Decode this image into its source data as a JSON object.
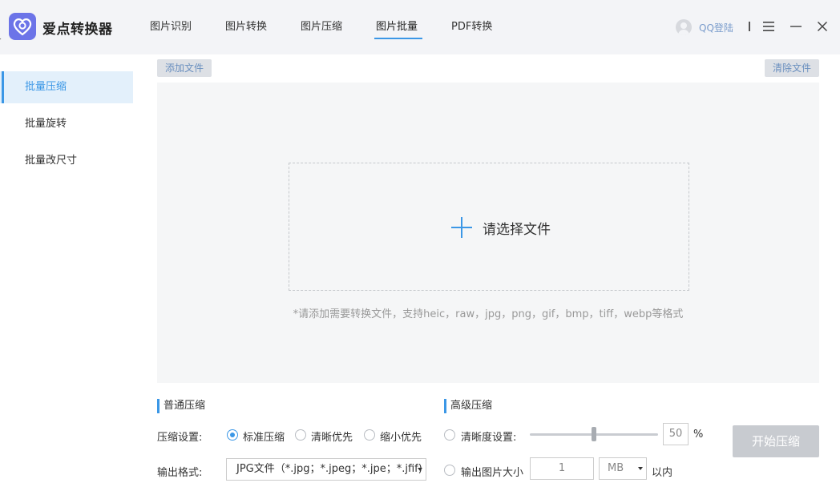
{
  "app": {
    "title": "爱点转换器"
  },
  "nav": {
    "tabs": [
      {
        "label": "图片识别"
      },
      {
        "label": "图片转换"
      },
      {
        "label": "图片压缩"
      },
      {
        "label": "图片批量"
      },
      {
        "label": "PDF转换"
      }
    ],
    "active_index": 3
  },
  "user": {
    "login_label": "QQ登陆"
  },
  "sidebar": {
    "items": [
      {
        "label": "批量压缩"
      },
      {
        "label": "批量旋转"
      },
      {
        "label": "批量改尺寸"
      }
    ],
    "active_index": 0
  },
  "toolbar": {
    "add_label": "添加文件",
    "clear_label": "清除文件"
  },
  "dropzone": {
    "prompt": "请选择文件",
    "hint": "*请添加需要转换文件，支持heic，raw，jpg，png，gif，bmp，tiff，webp等格式"
  },
  "normal": {
    "title": "普通压缩",
    "setting_label": "压缩设置:",
    "options": [
      {
        "label": "标准压缩",
        "checked": true
      },
      {
        "label": "清晰优先",
        "checked": false
      },
      {
        "label": "缩小优先",
        "checked": false
      }
    ],
    "format_label": "输出格式:",
    "format_value": "JPG文件（*.jpg；*.jpeg；*.jpe；*.jfif)"
  },
  "advanced": {
    "title": "高级压缩",
    "clarity_label": "清晰度设置:",
    "clarity_value": "50",
    "clarity_unit": "%",
    "clarity_level": 0.5,
    "size_label": "输出图片大小",
    "size_value": "1",
    "size_unit": "MB",
    "size_suffix": "以内"
  },
  "actions": {
    "start_label": "开始压缩"
  },
  "colors": {
    "accent": "#3b97e6",
    "logo": "#6c74e8",
    "disabled": "#c8cbd0"
  }
}
